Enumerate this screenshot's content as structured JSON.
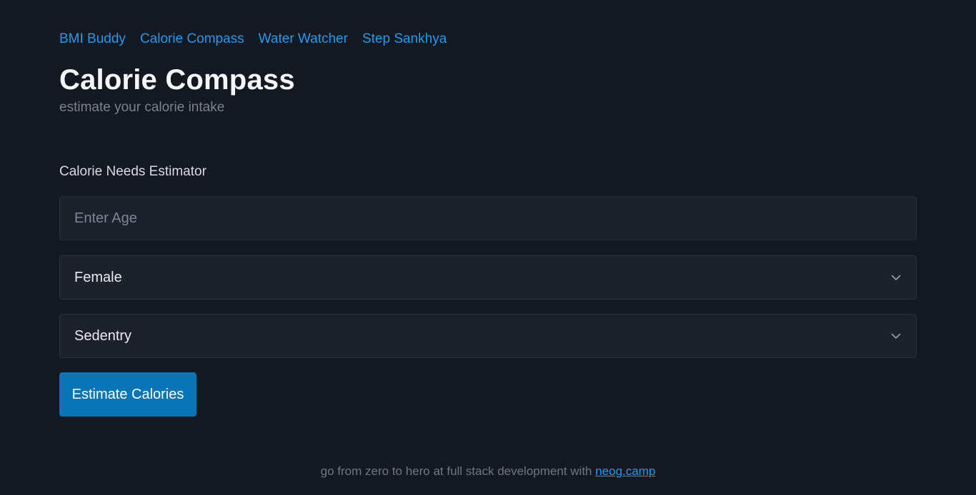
{
  "nav": {
    "links": [
      "BMI Buddy",
      "Calorie Compass",
      "Water Watcher",
      "Step Sankhya"
    ]
  },
  "header": {
    "title": "Calorie Compass",
    "subtitle": "estimate your calorie intake"
  },
  "form": {
    "section_label": "Calorie Needs Estimator",
    "age": {
      "placeholder": "Enter Age",
      "value": ""
    },
    "gender": {
      "selected": "Female"
    },
    "activity": {
      "selected": "Sedentry"
    },
    "submit_label": "Estimate Calories"
  },
  "footer": {
    "text": "go from zero to hero at full stack development with ",
    "link_text": "neog.camp"
  },
  "colors": {
    "background": "#141821",
    "accent_link": "#1e9bf0",
    "button": "#0775b8"
  },
  "icons": {
    "select_arrow": "chevron-down-icon"
  }
}
